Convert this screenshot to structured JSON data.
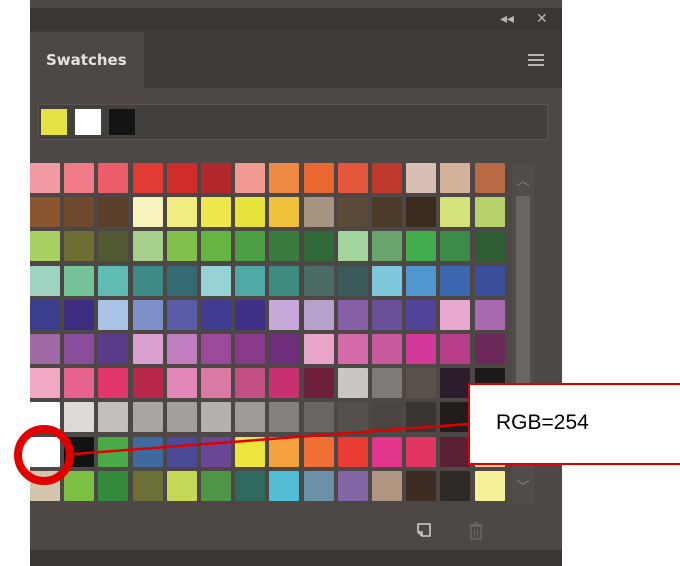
{
  "panel": {
    "tab_label": "Swatches",
    "controls": {
      "collapse_glyph": "◂◂",
      "close_glyph": "✕"
    }
  },
  "recent_swatches": [
    "#e5e246",
    "#ffffff",
    "#141414"
  ],
  "swatch_rows": [
    [
      "#f39ba5",
      "#f07a85",
      "#ec5d6a",
      "#e23a34",
      "#cf2c2a",
      "#b3282a",
      "#f19a92",
      "#ee8a45",
      "#e8682f",
      "#e4563b",
      "#bf3a2c",
      "#d7bfb5",
      "#d4b19a",
      "#b86a45"
    ],
    [
      "#8a5631",
      "#6f4a2f",
      "#5c3f29",
      "#f8f4bd",
      "#f2ec80",
      "#efe84c",
      "#e8e33a",
      "#f0c23b",
      "#a79581",
      "#5b4a38",
      "#4d3b2a",
      "#3b2c1f",
      "#d4e27a",
      "#b7d26a"
    ],
    [
      "#a8cf62",
      "#6e6e32",
      "#525a33",
      "#a6cf8c",
      "#82c04c",
      "#66b441",
      "#4c9e43",
      "#3b7b3d",
      "#2f6a38",
      "#a4d49e",
      "#6aa36d",
      "#42ad4c",
      "#3c8c47",
      "#2e5d34"
    ],
    [
      "#9fd3c2",
      "#76c39a",
      "#5fbcb1",
      "#3d8a86",
      "#346a72",
      "#97d3d6",
      "#4fa9a5",
      "#3e8b7f",
      "#4b6b66",
      "#3b5b5a",
      "#7fc7dd",
      "#5197cf",
      "#3c68b2",
      "#3a4e99"
    ],
    [
      "#3b3d8e",
      "#3d2d80",
      "#a9c2e6",
      "#7d90c7",
      "#5a5ca8",
      "#3f3b91",
      "#403088",
      "#c8a8d8",
      "#b6a0cc",
      "#8660a6",
      "#6a4f99",
      "#52449b",
      "#e9a8d0",
      "#a86ab0"
    ],
    [
      "#a06aa6",
      "#8a4d9c",
      "#5c3a8a",
      "#d9a0d0",
      "#c07ec0",
      "#9c4a9c",
      "#8a3a8a",
      "#6e2e7c",
      "#e9a6c8",
      "#d56aa8",
      "#c75a9e",
      "#d4399a",
      "#b83d89",
      "#6c2858"
    ],
    [
      "#f1a9c6",
      "#e8628e",
      "#e2356a",
      "#b8264a",
      "#e288b8",
      "#da7aa3",
      "#c24f82",
      "#c8316f",
      "#6d1f3b",
      "#cbc6c4",
      "#7f7a78",
      "#5a524a",
      "#2c1c2c",
      "#1f1a1a"
    ],
    [
      "#ffffff",
      "#dedad6",
      "#c3bfbb",
      "#aaa6a2",
      "#a3a09c",
      "#b5b0ac",
      "#9f9b97",
      "#86817d",
      "#6a6561",
      "#55504c",
      "#4a4541",
      "#3a3532",
      "#221d1a",
      "#1a1614"
    ],
    [
      "#ffffff",
      "#121212",
      "#48ab48",
      "#3f6a9d",
      "#4a4a96",
      "#6b4596",
      "#ece63c",
      "#f3a23e",
      "#ef6f35",
      "#e83c34",
      "#e2358c",
      "#e03563",
      "#5a2036",
      "#f6d194"
    ],
    [
      "#d6c5ad",
      "#7bc043",
      "#33893c",
      "#6a7038",
      "#c6d857",
      "#4f9648",
      "#2f6a5f",
      "#51bcd3",
      "#6b91a8",
      "#8465a5",
      "#b19681",
      "#3e2c22",
      "#2e2b26",
      "#f6f098"
    ]
  ],
  "bottom_bar": {
    "new_swatch_icon": "new-swatch-icon",
    "delete_icon": "trash-icon"
  },
  "annotation": {
    "label": "RGB=254",
    "color": "#e00000"
  }
}
